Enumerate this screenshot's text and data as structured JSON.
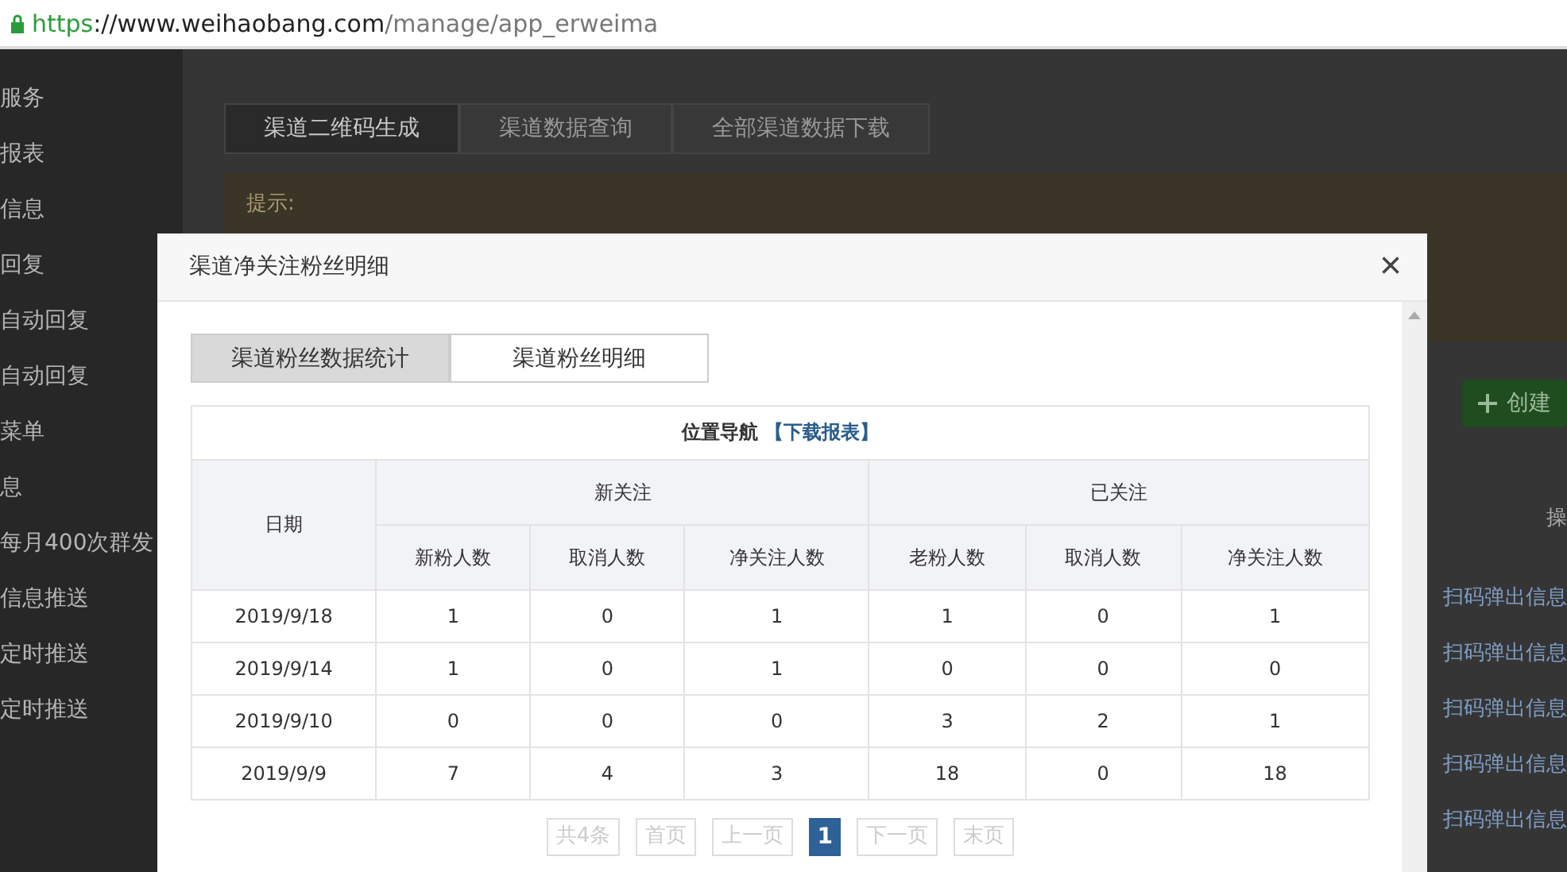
{
  "address_bar": {
    "scheme": "https",
    "host": "://www.weihaobang.com",
    "path": "/manage/app_erweima"
  },
  "sidebar": {
    "items": [
      "服务",
      "报表",
      "信息",
      "回复",
      "自动回复",
      "自动回复",
      "菜单",
      "息",
      "每月400次群发",
      "信息推送",
      "定时推送",
      "定时推送"
    ]
  },
  "page_tabs": [
    {
      "label": "渠道二维码生成",
      "selected": true
    },
    {
      "label": "渠道数据查询",
      "selected": false
    },
    {
      "label": "全部渠道数据下载",
      "selected": false
    }
  ],
  "tip": {
    "title": "提示:"
  },
  "create_button": "创建",
  "table_header": "操",
  "row_actions": [
    "扫码弹出信息",
    "扫码弹出信息",
    "扫码弹出信息",
    "扫码弹出信息",
    "扫码弹出信息"
  ],
  "modal": {
    "title": "渠道净关注粉丝明细",
    "close": "×",
    "tabs": [
      {
        "label": "渠道粉丝数据统计",
        "selected": true
      },
      {
        "label": "渠道粉丝明细",
        "selected": false
      }
    ],
    "table": {
      "caption": "位置导航",
      "download_link": "【下载报表】",
      "date_column": "日期",
      "groups": [
        {
          "label": "新关注",
          "columns": [
            "新粉人数",
            "取消人数",
            "净关注人数"
          ]
        },
        {
          "label": "已关注",
          "columns": [
            "老粉人数",
            "取消人数",
            "净关注人数"
          ]
        }
      ],
      "rows": [
        {
          "date": "2019/9/18",
          "values": [
            "1",
            "0",
            "1",
            "1",
            "0",
            "1"
          ]
        },
        {
          "date": "2019/9/14",
          "values": [
            "1",
            "0",
            "1",
            "0",
            "0",
            "0"
          ]
        },
        {
          "date": "2019/9/10",
          "values": [
            "0",
            "0",
            "0",
            "3",
            "2",
            "1"
          ]
        },
        {
          "date": "2019/9/9",
          "values": [
            "7",
            "4",
            "3",
            "18",
            "0",
            "18"
          ]
        }
      ]
    },
    "pagination": {
      "total": "共4条",
      "first": "首页",
      "prev": "上一页",
      "pages": [
        {
          "label": "1",
          "selected": true
        }
      ],
      "next": "下一页",
      "last": "末页"
    }
  }
}
